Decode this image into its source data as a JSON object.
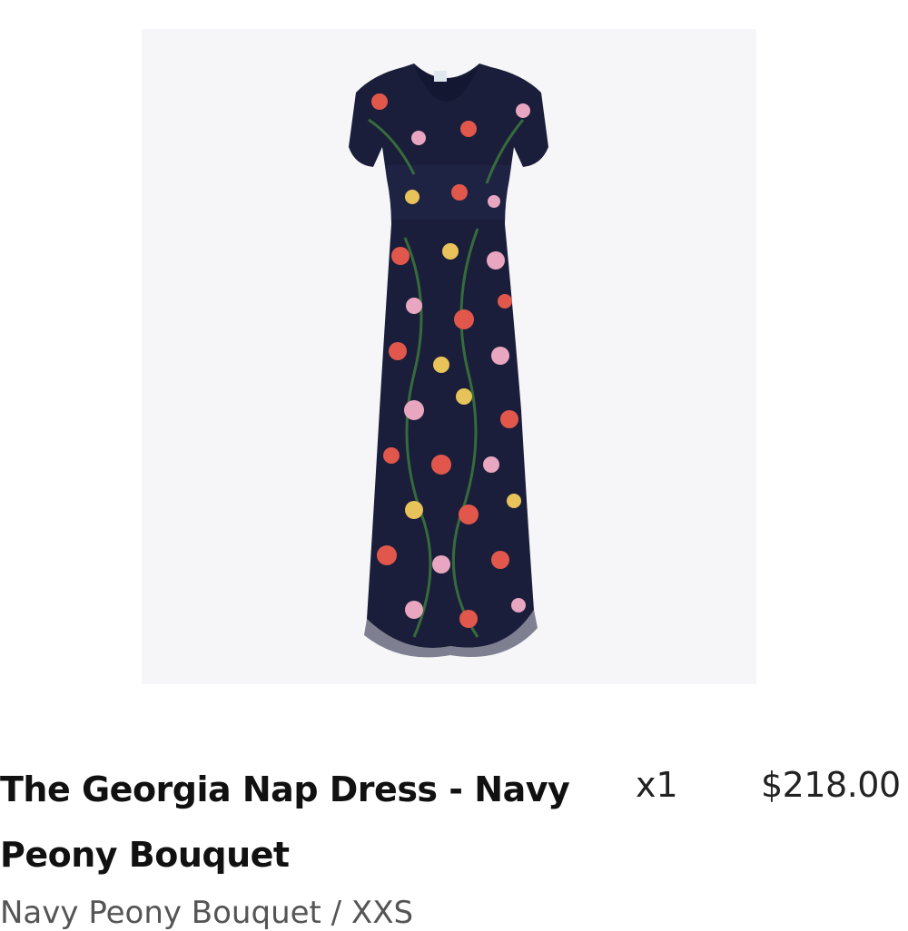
{
  "cart_item": {
    "image_alt": "navy floral midi dress product photo",
    "title": "The Georgia Nap Dress - Navy Peony Bouquet",
    "quantity": "x1",
    "price": "$218.00",
    "variant": "Navy Peony Bouquet / XXS"
  },
  "colors": {
    "image_bg": "#f6f6f8",
    "dress_navy": "#1b1e3a",
    "flower_coral": "#e2574c",
    "flower_pink": "#e9a6c0",
    "flower_yellow": "#e8c35a",
    "leaf_green": "#3b7a3c"
  }
}
